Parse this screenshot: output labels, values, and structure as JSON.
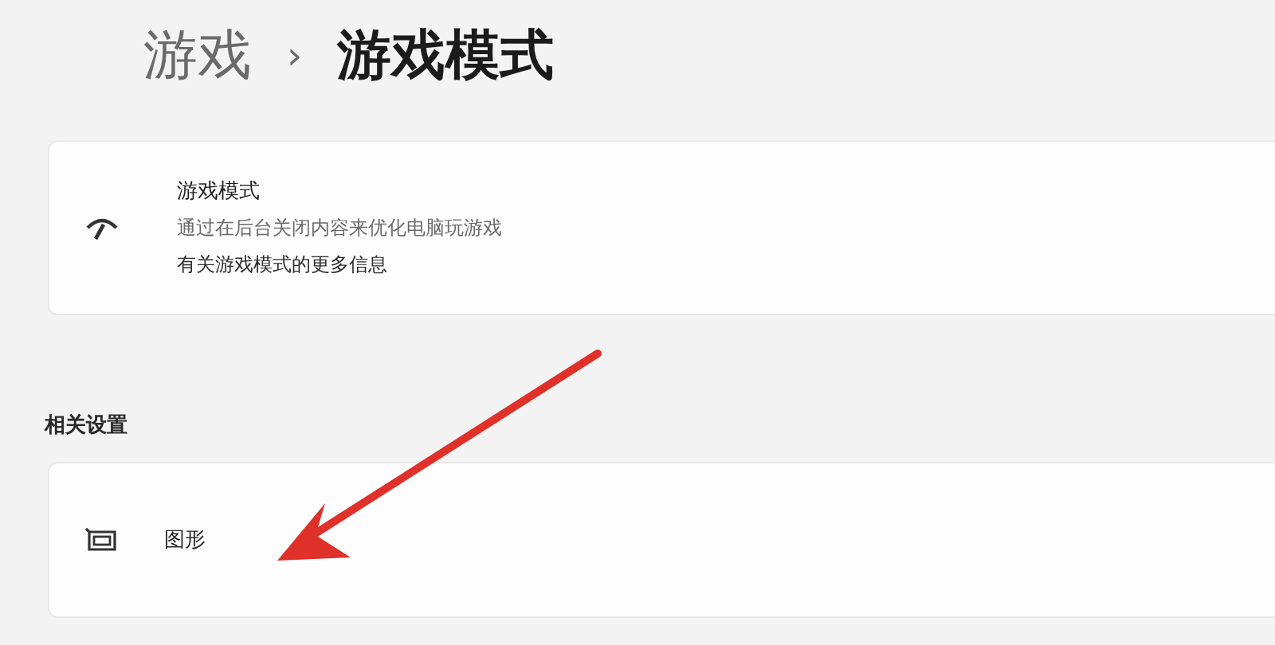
{
  "breadcrumb": {
    "parent": "游戏",
    "separator": "›",
    "current": "游戏模式"
  },
  "game_mode_card": {
    "title": "游戏模式",
    "description": "通过在后台关闭内容来优化电脑玩游戏",
    "link": "有关游戏模式的更多信息"
  },
  "related_settings": {
    "heading": "相关设置",
    "items": [
      {
        "label": "图形"
      }
    ]
  }
}
